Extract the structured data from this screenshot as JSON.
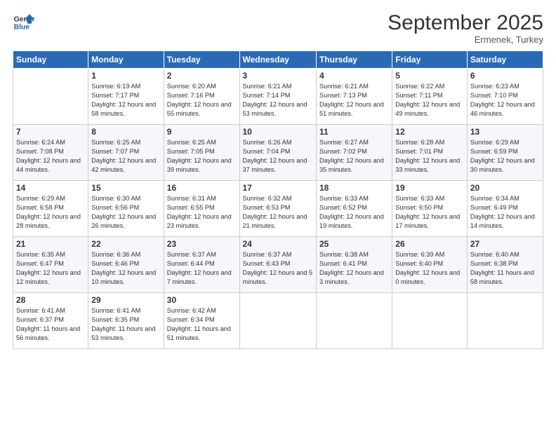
{
  "logo": {
    "line1": "General",
    "line2": "Blue"
  },
  "title": "September 2025",
  "subtitle": "Ermenek, Turkey",
  "days_header": [
    "Sunday",
    "Monday",
    "Tuesday",
    "Wednesday",
    "Thursday",
    "Friday",
    "Saturday"
  ],
  "weeks": [
    [
      {
        "num": "",
        "sunrise": "",
        "sunset": "",
        "daylight": ""
      },
      {
        "num": "1",
        "sunrise": "Sunrise: 6:19 AM",
        "sunset": "Sunset: 7:17 PM",
        "daylight": "Daylight: 12 hours and 58 minutes."
      },
      {
        "num": "2",
        "sunrise": "Sunrise: 6:20 AM",
        "sunset": "Sunset: 7:16 PM",
        "daylight": "Daylight: 12 hours and 55 minutes."
      },
      {
        "num": "3",
        "sunrise": "Sunrise: 6:21 AM",
        "sunset": "Sunset: 7:14 PM",
        "daylight": "Daylight: 12 hours and 53 minutes."
      },
      {
        "num": "4",
        "sunrise": "Sunrise: 6:21 AM",
        "sunset": "Sunset: 7:13 PM",
        "daylight": "Daylight: 12 hours and 51 minutes."
      },
      {
        "num": "5",
        "sunrise": "Sunrise: 6:22 AM",
        "sunset": "Sunset: 7:11 PM",
        "daylight": "Daylight: 12 hours and 49 minutes."
      },
      {
        "num": "6",
        "sunrise": "Sunrise: 6:23 AM",
        "sunset": "Sunset: 7:10 PM",
        "daylight": "Daylight: 12 hours and 46 minutes."
      }
    ],
    [
      {
        "num": "7",
        "sunrise": "Sunrise: 6:24 AM",
        "sunset": "Sunset: 7:08 PM",
        "daylight": "Daylight: 12 hours and 44 minutes."
      },
      {
        "num": "8",
        "sunrise": "Sunrise: 6:25 AM",
        "sunset": "Sunset: 7:07 PM",
        "daylight": "Daylight: 12 hours and 42 minutes."
      },
      {
        "num": "9",
        "sunrise": "Sunrise: 6:25 AM",
        "sunset": "Sunset: 7:05 PM",
        "daylight": "Daylight: 12 hours and 39 minutes."
      },
      {
        "num": "10",
        "sunrise": "Sunrise: 6:26 AM",
        "sunset": "Sunset: 7:04 PM",
        "daylight": "Daylight: 12 hours and 37 minutes."
      },
      {
        "num": "11",
        "sunrise": "Sunrise: 6:27 AM",
        "sunset": "Sunset: 7:02 PM",
        "daylight": "Daylight: 12 hours and 35 minutes."
      },
      {
        "num": "12",
        "sunrise": "Sunrise: 6:28 AM",
        "sunset": "Sunset: 7:01 PM",
        "daylight": "Daylight: 12 hours and 33 minutes."
      },
      {
        "num": "13",
        "sunrise": "Sunrise: 6:29 AM",
        "sunset": "Sunset: 6:59 PM",
        "daylight": "Daylight: 12 hours and 30 minutes."
      }
    ],
    [
      {
        "num": "14",
        "sunrise": "Sunrise: 6:29 AM",
        "sunset": "Sunset: 6:58 PM",
        "daylight": "Daylight: 12 hours and 28 minutes."
      },
      {
        "num": "15",
        "sunrise": "Sunrise: 6:30 AM",
        "sunset": "Sunset: 6:56 PM",
        "daylight": "Daylight: 12 hours and 26 minutes."
      },
      {
        "num": "16",
        "sunrise": "Sunrise: 6:31 AM",
        "sunset": "Sunset: 6:55 PM",
        "daylight": "Daylight: 12 hours and 23 minutes."
      },
      {
        "num": "17",
        "sunrise": "Sunrise: 6:32 AM",
        "sunset": "Sunset: 6:53 PM",
        "daylight": "Daylight: 12 hours and 21 minutes."
      },
      {
        "num": "18",
        "sunrise": "Sunrise: 6:33 AM",
        "sunset": "Sunset: 6:52 PM",
        "daylight": "Daylight: 12 hours and 19 minutes."
      },
      {
        "num": "19",
        "sunrise": "Sunrise: 6:33 AM",
        "sunset": "Sunset: 6:50 PM",
        "daylight": "Daylight: 12 hours and 17 minutes."
      },
      {
        "num": "20",
        "sunrise": "Sunrise: 6:34 AM",
        "sunset": "Sunset: 6:49 PM",
        "daylight": "Daylight: 12 hours and 14 minutes."
      }
    ],
    [
      {
        "num": "21",
        "sunrise": "Sunrise: 6:35 AM",
        "sunset": "Sunset: 6:47 PM",
        "daylight": "Daylight: 12 hours and 12 minutes."
      },
      {
        "num": "22",
        "sunrise": "Sunrise: 6:36 AM",
        "sunset": "Sunset: 6:46 PM",
        "daylight": "Daylight: 12 hours and 10 minutes."
      },
      {
        "num": "23",
        "sunrise": "Sunrise: 6:37 AM",
        "sunset": "Sunset: 6:44 PM",
        "daylight": "Daylight: 12 hours and 7 minutes."
      },
      {
        "num": "24",
        "sunrise": "Sunrise: 6:37 AM",
        "sunset": "Sunset: 6:43 PM",
        "daylight": "Daylight: 12 hours and 5 minutes."
      },
      {
        "num": "25",
        "sunrise": "Sunrise: 6:38 AM",
        "sunset": "Sunset: 6:41 PM",
        "daylight": "Daylight: 12 hours and 3 minutes."
      },
      {
        "num": "26",
        "sunrise": "Sunrise: 6:39 AM",
        "sunset": "Sunset: 6:40 PM",
        "daylight": "Daylight: 12 hours and 0 minutes."
      },
      {
        "num": "27",
        "sunrise": "Sunrise: 6:40 AM",
        "sunset": "Sunset: 6:38 PM",
        "daylight": "Daylight: 11 hours and 58 minutes."
      }
    ],
    [
      {
        "num": "28",
        "sunrise": "Sunrise: 6:41 AM",
        "sunset": "Sunset: 6:37 PM",
        "daylight": "Daylight: 11 hours and 56 minutes."
      },
      {
        "num": "29",
        "sunrise": "Sunrise: 6:41 AM",
        "sunset": "Sunset: 6:35 PM",
        "daylight": "Daylight: 11 hours and 53 minutes."
      },
      {
        "num": "30",
        "sunrise": "Sunrise: 6:42 AM",
        "sunset": "Sunset: 6:34 PM",
        "daylight": "Daylight: 11 hours and 51 minutes."
      },
      {
        "num": "",
        "sunrise": "",
        "sunset": "",
        "daylight": ""
      },
      {
        "num": "",
        "sunrise": "",
        "sunset": "",
        "daylight": ""
      },
      {
        "num": "",
        "sunrise": "",
        "sunset": "",
        "daylight": ""
      },
      {
        "num": "",
        "sunrise": "",
        "sunset": "",
        "daylight": ""
      }
    ]
  ]
}
